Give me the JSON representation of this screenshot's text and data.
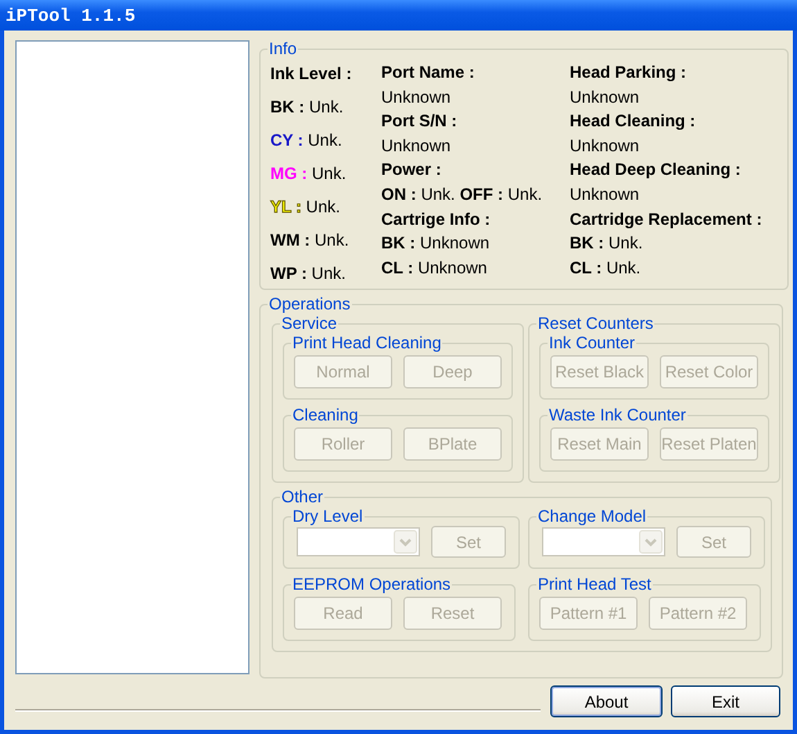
{
  "window": {
    "title": "iPTool 1.1.5"
  },
  "info": {
    "title": "Info",
    "ink_level": {
      "label": "Ink Level :",
      "inks": [
        {
          "key": "BK :",
          "value": "Unk.",
          "color": "#000000"
        },
        {
          "key": "CY :",
          "value": "Unk.",
          "color": "#1818c8"
        },
        {
          "key": "MG :",
          "value": "Unk.",
          "color": "#ff00ff"
        },
        {
          "key": "YL :",
          "value": "Unk.",
          "color": "#ffff00"
        },
        {
          "key": "WM :",
          "value": "Unk.",
          "color": "#000000"
        },
        {
          "key": "WP :",
          "value": "Unk.",
          "color": "#000000"
        }
      ]
    },
    "columns": [
      [
        {
          "label": "Port Name :",
          "lines": [
            [
              {
                "value": "Unknown"
              }
            ]
          ]
        },
        {
          "label": "Port S/N :",
          "lines": [
            [
              {
                "value": "Unknown"
              }
            ]
          ]
        },
        {
          "label": "Power :",
          "lines": [
            [
              {
                "key": "ON :",
                "value": "Unk."
              },
              {
                "key": "OFF :",
                "value": "Unk."
              }
            ]
          ]
        },
        {
          "label": "Cartrige Info :",
          "lines": [
            [
              {
                "key": "BK :",
                "value": "Unknown"
              }
            ],
            [
              {
                "key": "CL :",
                "value": "Unknown"
              }
            ]
          ]
        }
      ],
      [
        {
          "label": "Head Parking :",
          "lines": [
            [
              {
                "value": "Unknown"
              }
            ]
          ]
        },
        {
          "label": "Head Cleaning :",
          "lines": [
            [
              {
                "value": "Unknown"
              }
            ]
          ]
        },
        {
          "label": "Head Deep Cleaning :",
          "lines": [
            [
              {
                "value": "Unknown"
              }
            ]
          ]
        },
        {
          "label": "Cartridge Replacement :",
          "lines": [
            [
              {
                "key": "BK :",
                "value": "Unk."
              }
            ],
            [
              {
                "key": "CL :",
                "value": "Unk."
              }
            ]
          ]
        }
      ]
    ]
  },
  "operations": {
    "title": "Operations",
    "sections": [
      {
        "title": "Service",
        "kind": "stack",
        "groups": [
          {
            "title": "Print Head Cleaning",
            "kind": "buttons",
            "buttons": [
              {
                "label": "Normal",
                "disabled": true
              },
              {
                "label": "Deep",
                "disabled": true
              }
            ]
          },
          {
            "title": "Cleaning",
            "kind": "buttons",
            "buttons": [
              {
                "label": "Roller",
                "disabled": true
              },
              {
                "label": "BPlate",
                "disabled": true
              }
            ]
          }
        ]
      },
      {
        "title": "Reset Counters",
        "kind": "stack",
        "groups": [
          {
            "title": "Ink Counter",
            "kind": "buttons",
            "buttons": [
              {
                "label": "Reset Black",
                "disabled": true
              },
              {
                "label": "Reset Color",
                "disabled": true
              }
            ]
          },
          {
            "title": "Waste Ink Counter",
            "kind": "buttons",
            "buttons": [
              {
                "label": "Reset Main",
                "disabled": true
              },
              {
                "label": "Reset Platen",
                "disabled": true
              }
            ]
          }
        ]
      },
      {
        "title": "Other",
        "kind": "grid",
        "groups": [
          {
            "title": "Dry Level",
            "kind": "select",
            "disabled": true,
            "buttons": [
              {
                "label": "Set",
                "disabled": true
              }
            ]
          },
          {
            "title": "Change Model",
            "kind": "select",
            "disabled": true,
            "buttons": [
              {
                "label": "Set",
                "disabled": true
              }
            ]
          },
          {
            "title": "EEPROM Operations",
            "kind": "buttons",
            "buttons": [
              {
                "label": "Read",
                "disabled": true
              },
              {
                "label": "Reset",
                "disabled": true
              }
            ]
          },
          {
            "title": "Print Head Test",
            "kind": "buttons",
            "buttons": [
              {
                "label": "Pattern #1",
                "disabled": true
              },
              {
                "label": "Pattern #2",
                "disabled": true
              }
            ]
          }
        ]
      }
    ]
  },
  "footer_buttons": [
    {
      "label": "About",
      "default": true
    },
    {
      "label": "Exit",
      "default": false
    }
  ]
}
